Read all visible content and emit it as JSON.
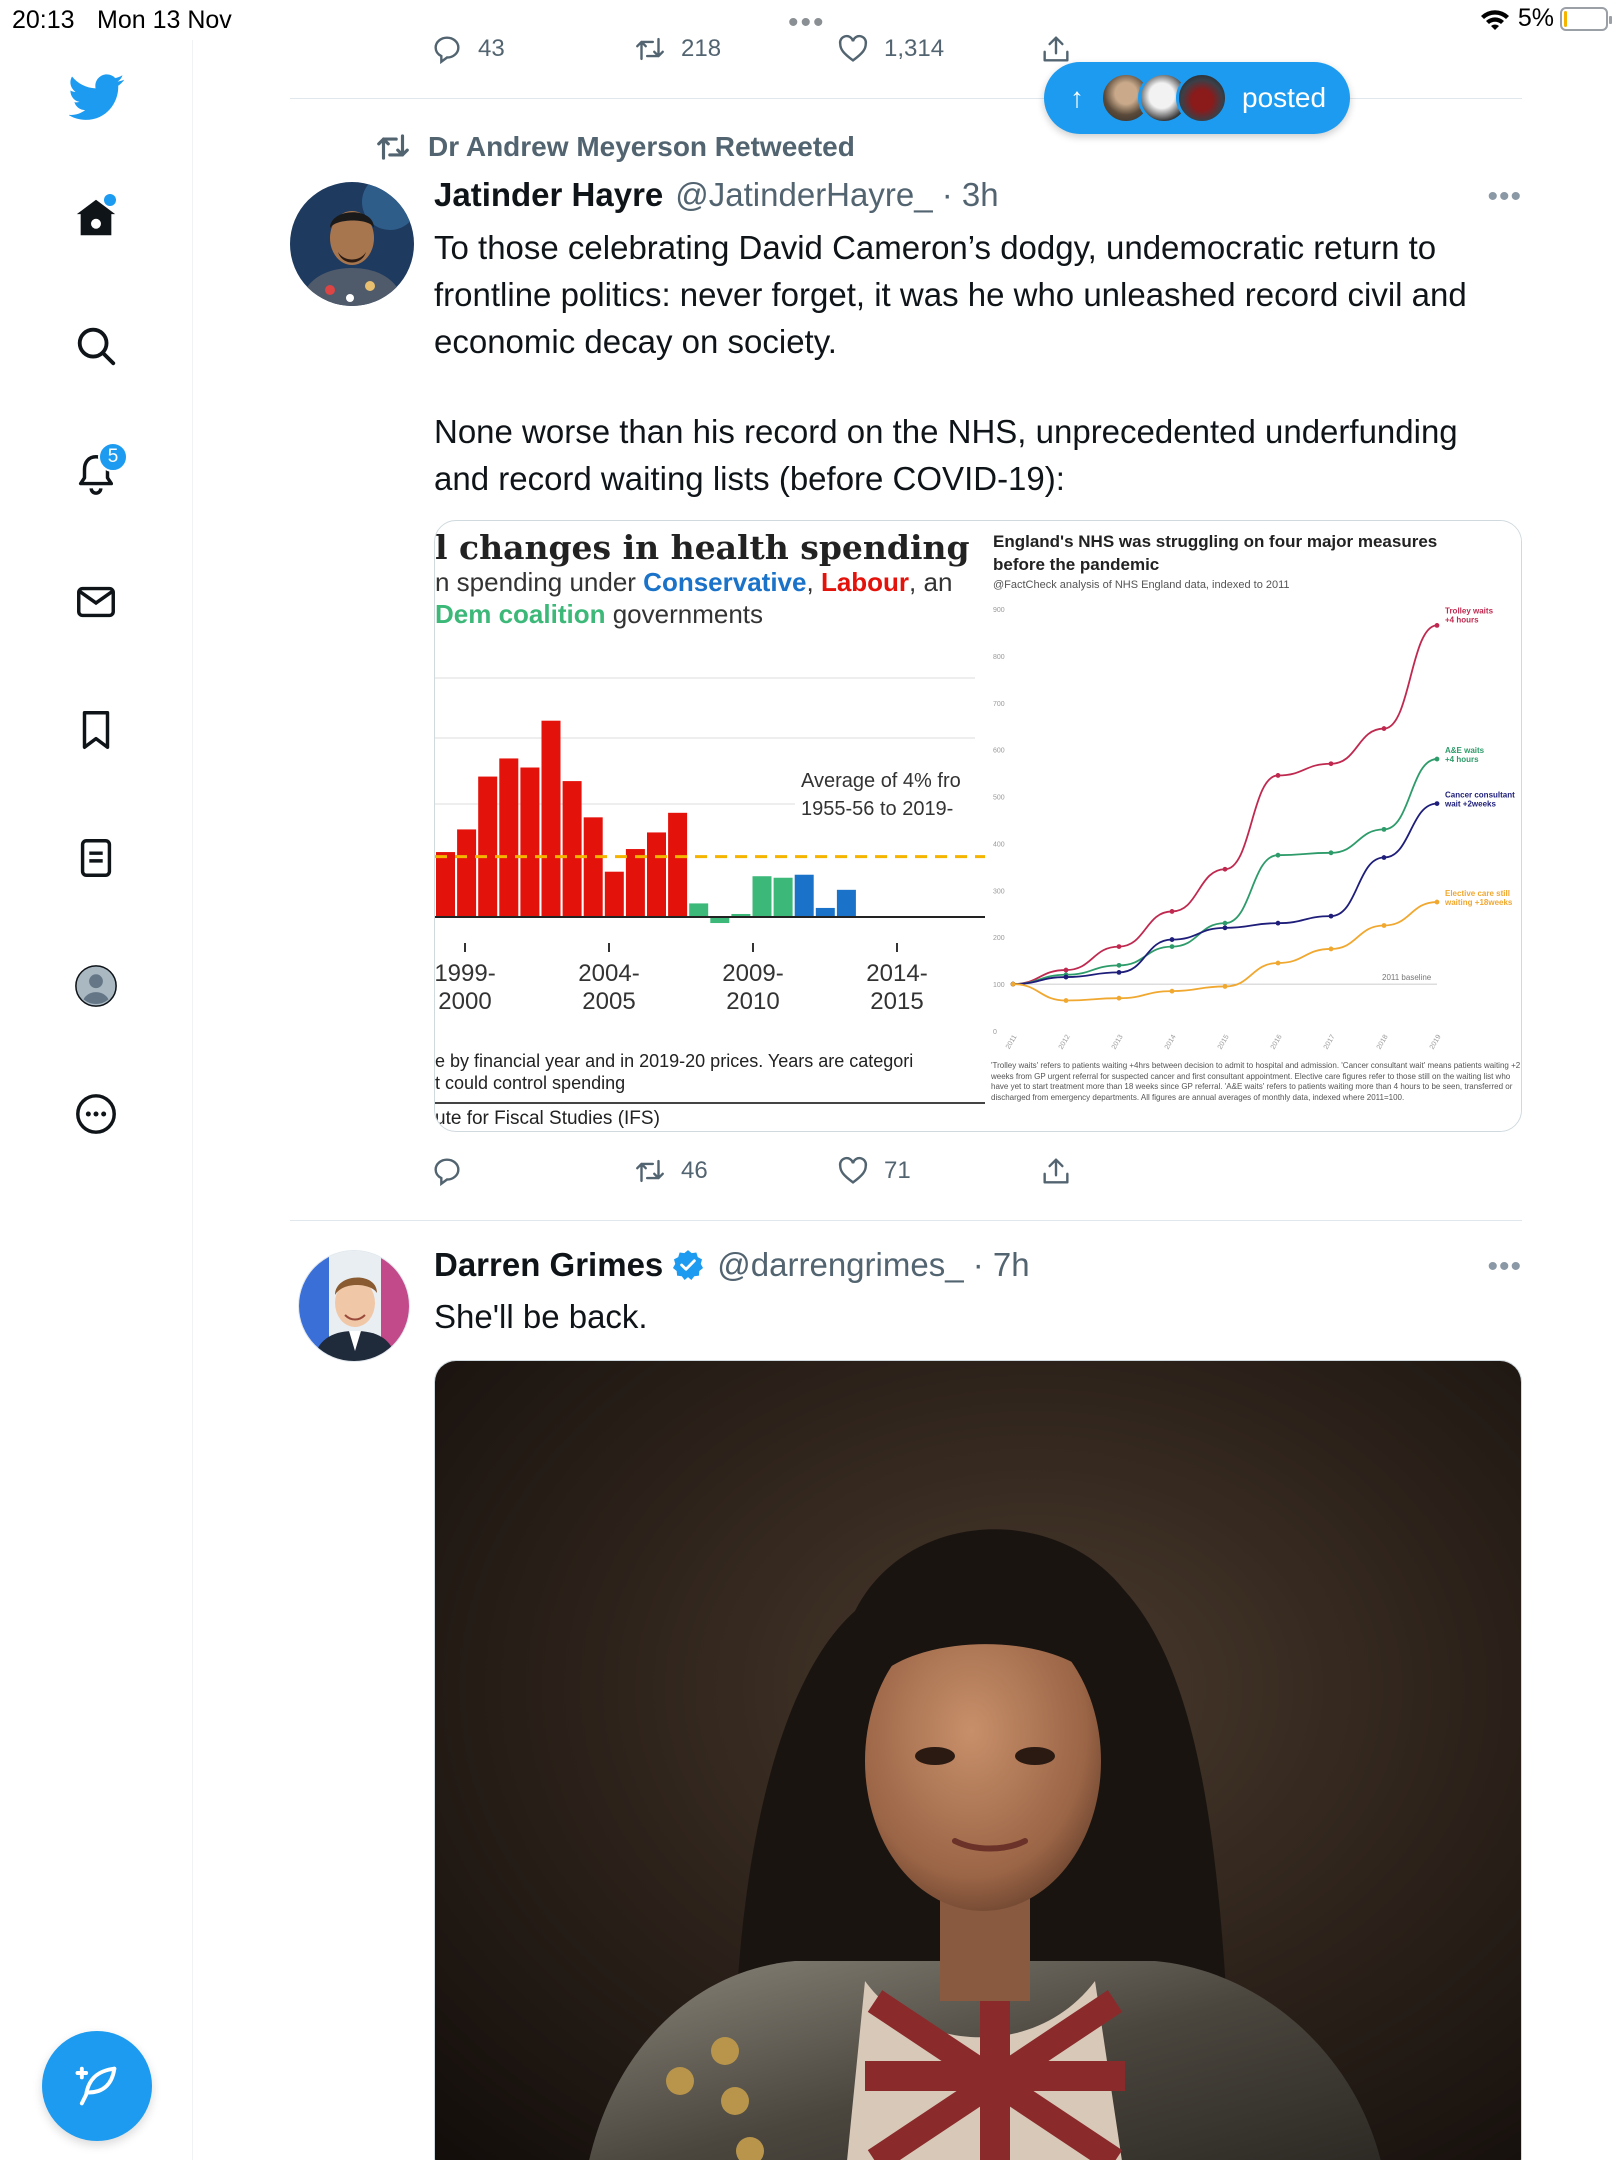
{
  "status_bar": {
    "time": "20:13",
    "date": "Mon 13 Nov",
    "battery": "5%",
    "battery_level": 0.05
  },
  "sidebar": {
    "notification_count": "5",
    "items": [
      "home-icon",
      "search-icon",
      "bell-icon",
      "mail-icon",
      "bookmark-icon",
      "list-icon",
      "profile-icon",
      "more-icon"
    ]
  },
  "top_tweet_actions": {
    "replies": "43",
    "retweets": "218",
    "likes": "1,314"
  },
  "posted_pill": {
    "label": "posted"
  },
  "tweet1": {
    "retweeted_by": "Dr Andrew Meyerson Retweeted",
    "name": "Jatinder Hayre",
    "handle": "@JatinderHayre_ · 3h",
    "text_p1": "To those celebrating David Cameron’s dodgy, undemocratic return to frontline politics: never forget, it was he who unleashed record civil and economic decay on society.",
    "text_p2": "None worse than his record on the NHS, unprecedented underfunding and record waiting lists (before COVID-19):",
    "retweets": "46",
    "likes": "71"
  },
  "tweet2": {
    "name": "Darren Grimes",
    "handle": "@darrengrimes_ · 7h",
    "text": "She'll be back."
  },
  "chart_data": [
    {
      "type": "bar",
      "title": "l changes in health spending",
      "subtitle_prefix": "n spending under ",
      "subtitle_conservative": "Conservative",
      "subtitle_comma": ", ",
      "subtitle_labour": "Labour",
      "subtitle_an": ", an",
      "subtitle_libdem": "Dem coalition",
      "subtitle_suffix": " governments",
      "annotation_line1": "Average of 4% fro",
      "annotation_line2": "1955-56 to 2019-",
      "average": 4,
      "tick_labels": [
        [
          "1999-",
          "2000"
        ],
        [
          "2004-",
          "2005"
        ],
        [
          "2009-",
          "2010"
        ],
        [
          "2014-",
          "2015"
        ]
      ],
      "footnote1": "e by financial year and in 2019-20 prices. Years are categori",
      "footnote2": "t could control spending",
      "source": "ute for Fiscal Studies (IFS)",
      "colors": {
        "labour": "#e3120b",
        "coalition": "#3cb878",
        "conservative": "#1a73c8",
        "average": "#f5b400"
      },
      "bars": [
        {
          "v": 4.3,
          "c": "labour"
        },
        {
          "v": 5.8,
          "c": "labour"
        },
        {
          "v": 9.3,
          "c": "labour"
        },
        {
          "v": 10.5,
          "c": "labour"
        },
        {
          "v": 9.9,
          "c": "labour"
        },
        {
          "v": 13.0,
          "c": "labour"
        },
        {
          "v": 9.0,
          "c": "labour"
        },
        {
          "v": 6.6,
          "c": "labour"
        },
        {
          "v": 3.0,
          "c": "labour"
        },
        {
          "v": 4.5,
          "c": "labour"
        },
        {
          "v": 5.6,
          "c": "labour"
        },
        {
          "v": 6.9,
          "c": "labour"
        },
        {
          "v": 0.9,
          "c": "coalition"
        },
        {
          "v": -0.4,
          "c": "coalition"
        },
        {
          "v": 0.2,
          "c": "coalition"
        },
        {
          "v": 2.7,
          "c": "coalition"
        },
        {
          "v": 2.6,
          "c": "coalition"
        },
        {
          "v": 2.8,
          "c": "conservative"
        },
        {
          "v": 0.6,
          "c": "conservative"
        },
        {
          "v": 1.8,
          "c": "conservative"
        }
      ]
    },
    {
      "type": "line",
      "title": "England's NHS was struggling on four major measures before the pandemic",
      "subtitle": "@FactCheck analysis of NHS England data, indexed to 2011",
      "x": [
        "2011",
        "2012",
        "2013",
        "2014",
        "2015",
        "2016",
        "2017",
        "2018",
        "2019"
      ],
      "ylim": [
        0,
        900
      ],
      "yticks": [
        "0",
        "100",
        "200",
        "300",
        "400",
        "500",
        "600",
        "700",
        "800",
        "900"
      ],
      "baseline_label": "2011 baseline",
      "series": [
        {
          "name": "Trolley waits +4 hours",
          "color": "#c0294f",
          "values": [
            100,
            130,
            180,
            255,
            345,
            545,
            570,
            645,
            865
          ]
        },
        {
          "name": "A&E waits +4 hours",
          "color": "#2d9b6a",
          "values": [
            100,
            120,
            140,
            180,
            230,
            375,
            380,
            430,
            580
          ]
        },
        {
          "name": "Cancer consultant wait +2weeks",
          "color": "#1e1e7a",
          "values": [
            100,
            115,
            125,
            195,
            220,
            230,
            245,
            370,
            485
          ]
        },
        {
          "name": "Elective care still waiting +18weeks",
          "color": "#f0a830",
          "values": [
            100,
            65,
            70,
            85,
            95,
            145,
            175,
            225,
            275
          ]
        }
      ],
      "footnote": "'Trolley waits' refers to patients waiting +4hrs between decision to admit to hospital and admission. 'Cancer consultant wait' means patients waiting +2 weeks from GP urgent referral for suspected cancer and first consultant appointment. Elective care figures refer to those still on the waiting list who have yet to start treatment more than 18 weeks since GP referral. 'A&E waits' refers to patients waiting more than 4 hours to be seen, transferred or discharged from emergency departments. All figures are annual averages of monthly data, indexed where 2011=100."
    }
  ]
}
